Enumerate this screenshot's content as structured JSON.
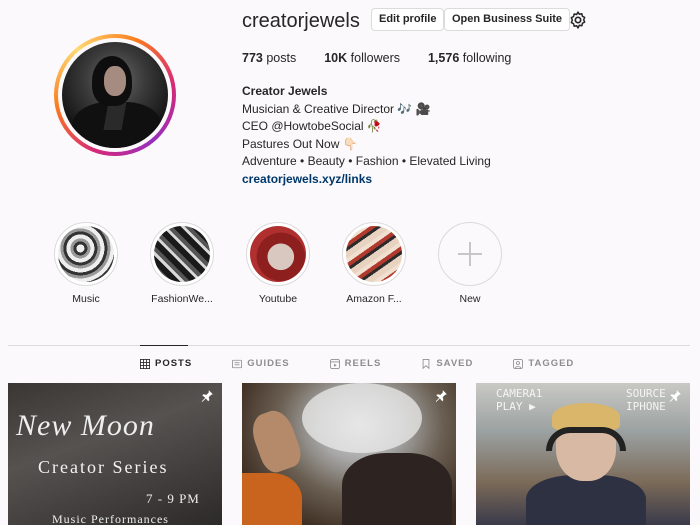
{
  "profile": {
    "username": "creatorjewels",
    "edit_button": "Edit profile",
    "business_button": "Open Business Suite",
    "stats": {
      "posts_count": "773",
      "posts_label": "posts",
      "followers_count": "10K",
      "followers_label": "followers",
      "following_count": "1,576",
      "following_label": "following"
    },
    "bio": {
      "name": "Creator Jewels",
      "line1": "Musician & Creative Director 🎶 🎥",
      "line2": "CEO @HowtobeSocial 🥀",
      "line3": "Pastures Out Now 👇🏻",
      "line4": "Adventure • Beauty • Fashion • Elevated Living",
      "link": "creatorjewels.xyz/links"
    }
  },
  "highlights": [
    {
      "label": "Music"
    },
    {
      "label": "FashionWe..."
    },
    {
      "label": "Youtube"
    },
    {
      "label": "Amazon F..."
    },
    {
      "label": "New"
    }
  ],
  "tabs": [
    {
      "label": "POSTS",
      "icon": "grid-icon",
      "active": true
    },
    {
      "label": "GUIDES",
      "icon": "guides-icon",
      "active": false
    },
    {
      "label": "REELS",
      "icon": "reels-icon",
      "active": false
    },
    {
      "label": "SAVED",
      "icon": "bookmark-icon",
      "active": false
    },
    {
      "label": "TAGGED",
      "icon": "tagged-icon",
      "active": false
    }
  ],
  "posts": [
    {
      "pinned": true,
      "title": "New Moon",
      "subtitle": "Creator Series",
      "time": "7 - 9 PM",
      "footer": "Music Performances"
    },
    {
      "pinned": true
    },
    {
      "pinned": true,
      "overlay_left_1": "CAMERA1",
      "overlay_left_2": "PLAY ▶",
      "overlay_right_1": "SOURCE",
      "overlay_right_2": "IPHONE"
    }
  ],
  "colors": {
    "background": "#fbf9fb",
    "link": "#00376b",
    "ring_start": "#d62976",
    "ring_mid": "#fa7e1e",
    "ring_end": "#962fbf"
  }
}
